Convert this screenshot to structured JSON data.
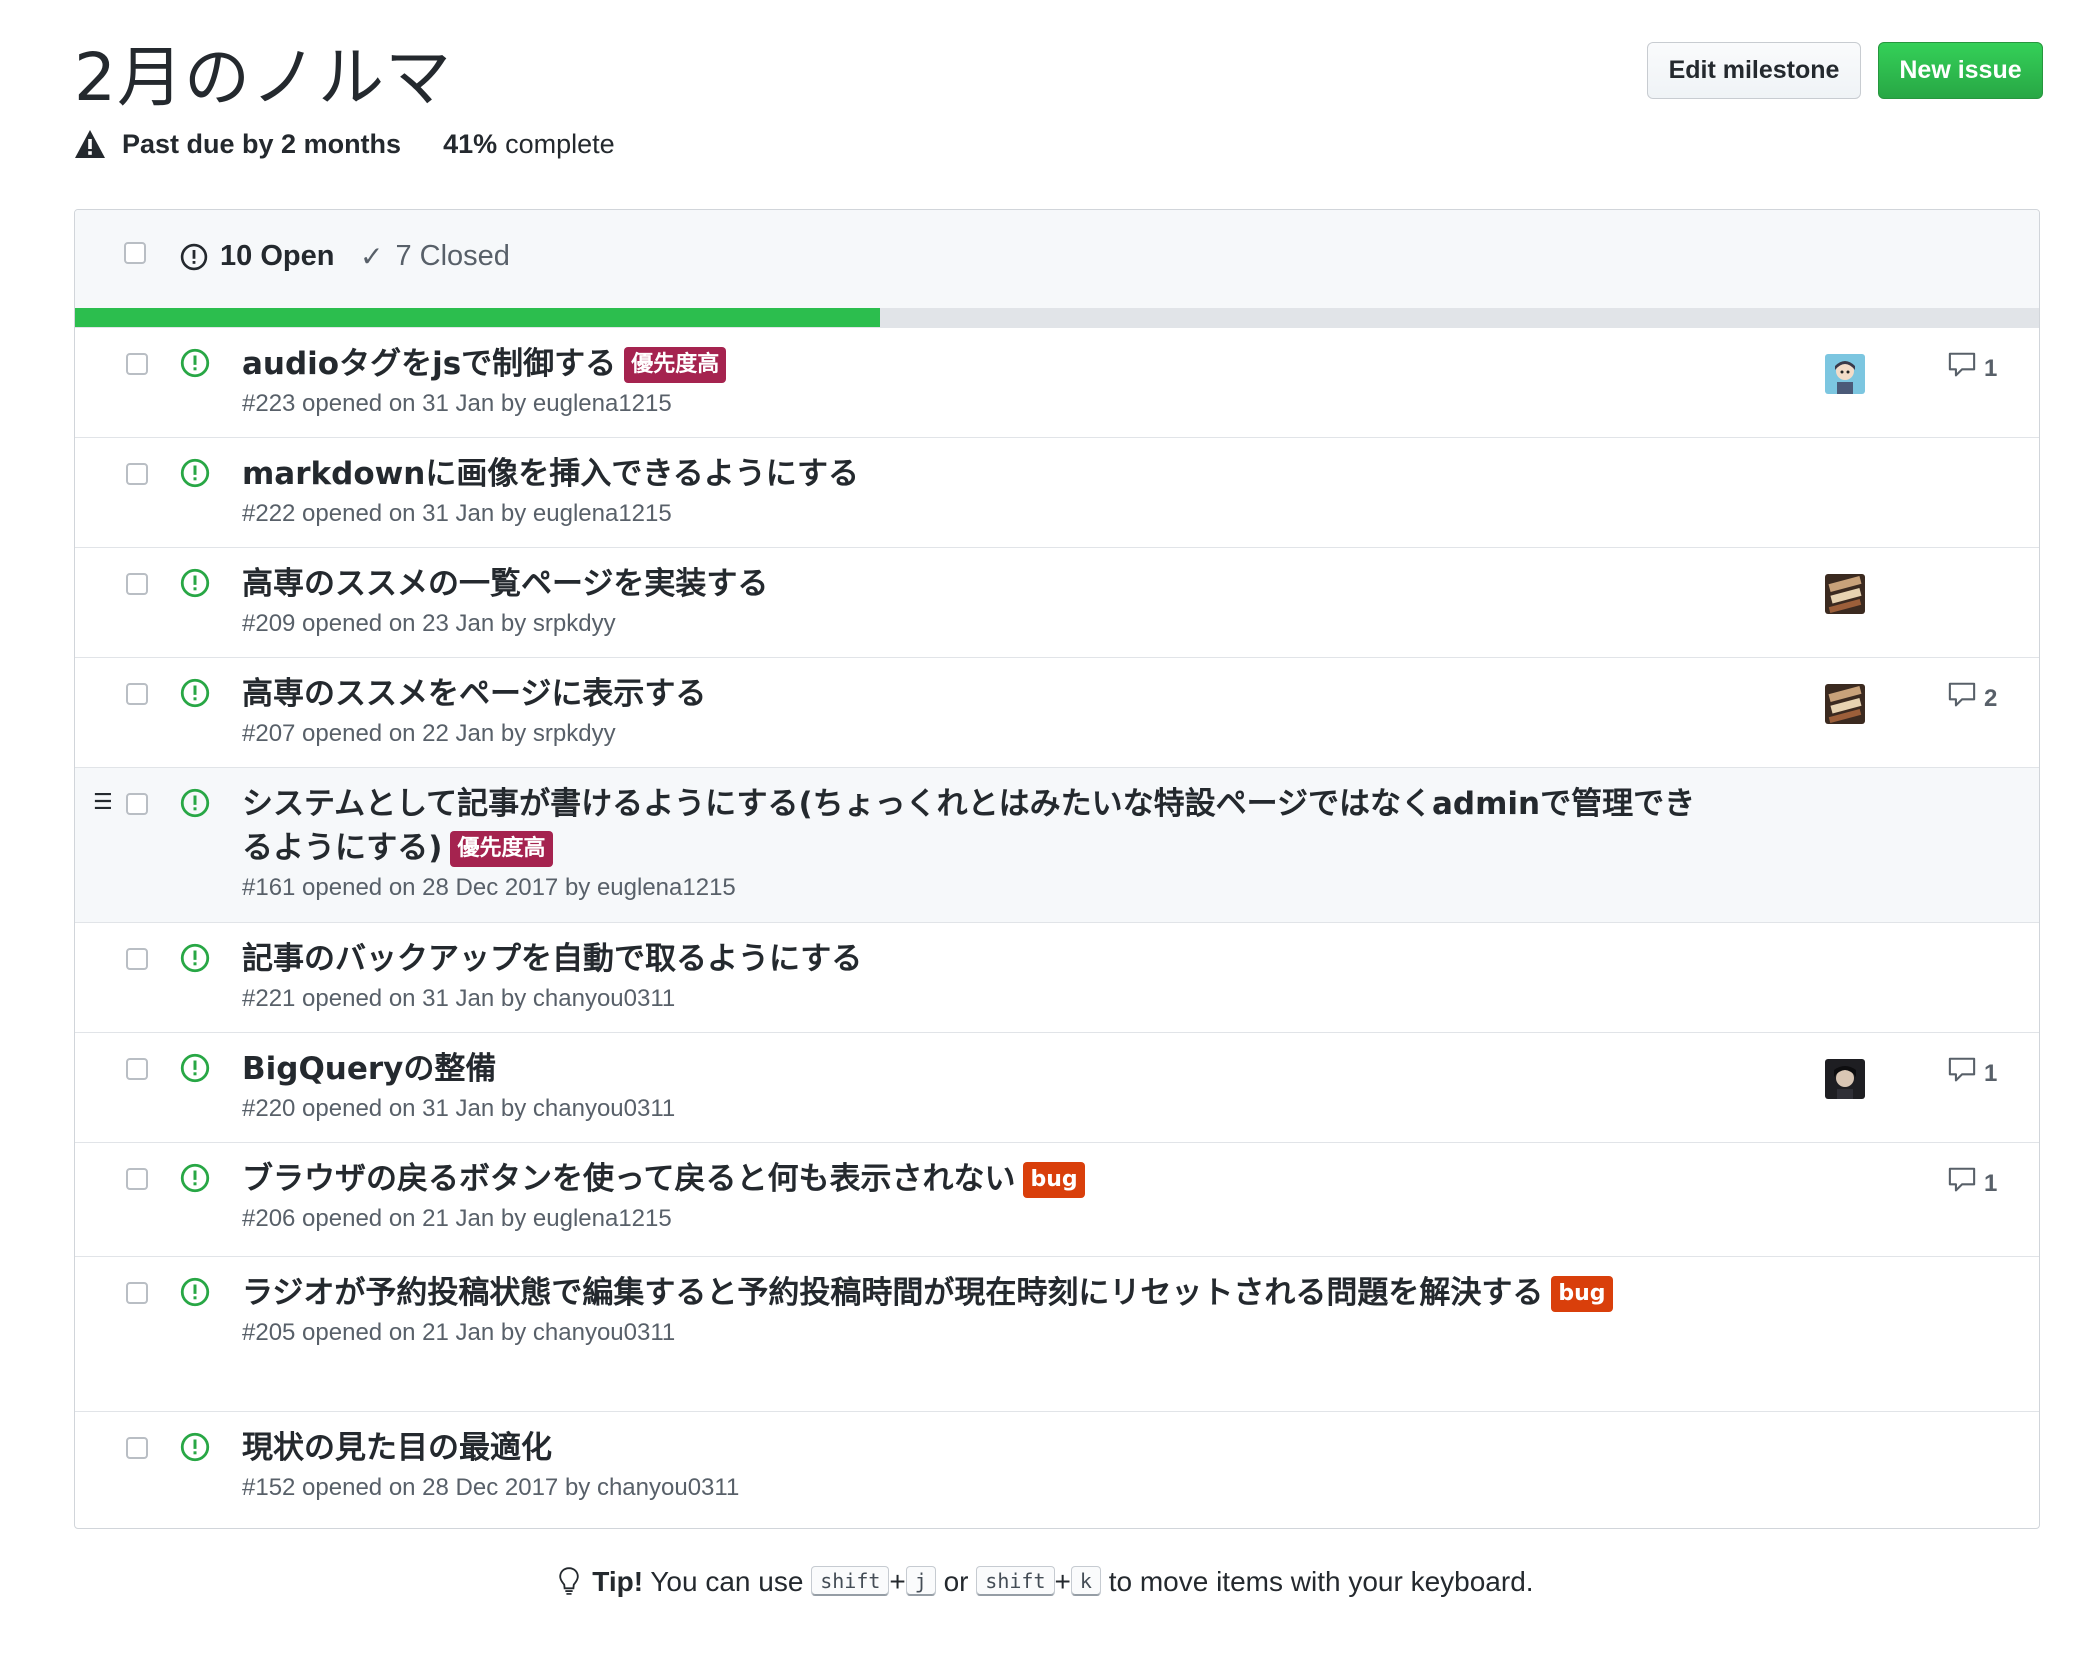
{
  "milestone": {
    "title": "2月のノルマ",
    "due_text": "Past due by 2 months",
    "percent": "41%",
    "complete_text": "complete",
    "progress_fraction": 0.41
  },
  "buttons": {
    "edit": "Edit milestone",
    "new_issue": "New issue"
  },
  "header": {
    "open": "10 Open",
    "closed": "7 Closed"
  },
  "colors": {
    "open_icon": "#28a745",
    "progress": "#2cbe4e",
    "label_priority": "#a5234f",
    "label_bug": "#d93f0b"
  },
  "issues": [
    {
      "title": "audioタグをjsで制御する",
      "labels": [
        "優先度高"
      ],
      "meta": "#223 opened on 31 Jan by euglena1215",
      "comments": "1",
      "avatar": "avatar-anime"
    },
    {
      "title": "markdownに画像を挿入できるようにする",
      "labels": [],
      "meta": "#222 opened on 31 Jan by euglena1215",
      "comments": "",
      "avatar": ""
    },
    {
      "title": "高専のススメの一覧ページを実装する",
      "labels": [],
      "meta": "#209 opened on 23 Jan by srpkdyy",
      "comments": "",
      "avatar": "avatar-photo"
    },
    {
      "title": "高専のススメをページに表示する",
      "labels": [],
      "meta": "#207 opened on 22 Jan by srpkdyy",
      "comments": "2",
      "avatar": "avatar-photo"
    },
    {
      "title": "システムとして記事が書けるようにする(ちょっくれとはみたいな特設ページではなくadminで管理できるようにする)",
      "labels": [
        "優先度高"
      ],
      "meta": "#161 opened on 28 Dec 2017 by euglena1215",
      "comments": "",
      "avatar": ""
    },
    {
      "title": "記事のバックアップを自動で取るようにする",
      "labels": [],
      "meta": "#221 opened on 31 Jan by chanyou0311",
      "comments": "",
      "avatar": ""
    },
    {
      "title": "BigQueryの整備",
      "labels": [],
      "meta": "#220 opened on 31 Jan by chanyou0311",
      "comments": "1",
      "avatar": "avatar-dark"
    },
    {
      "title": "ブラウザの戻るボタンを使って戻ると何も表示されない",
      "labels": [
        "bug"
      ],
      "meta": "#206 opened on 21 Jan by euglena1215",
      "comments": "1",
      "avatar": ""
    },
    {
      "title": "ラジオが予約投稿状態で編集すると予約投稿時間が現在時刻にリセットされる問題を解決する",
      "labels": [
        "bug"
      ],
      "meta": "#205 opened on 21 Jan by chanyou0311",
      "comments": "",
      "avatar": ""
    },
    {
      "title": "現状の見た目の最適化",
      "labels": [],
      "meta": "#152 opened on 28 Dec 2017 by chanyou0311",
      "comments": "",
      "avatar": ""
    }
  ],
  "tip": {
    "prefix": "Tip!",
    "text1": "You can use",
    "key_shift": "shift",
    "plus": "+",
    "key_j": "j",
    "or": "or",
    "key_k": "k",
    "text2": "to move items with your keyboard."
  }
}
